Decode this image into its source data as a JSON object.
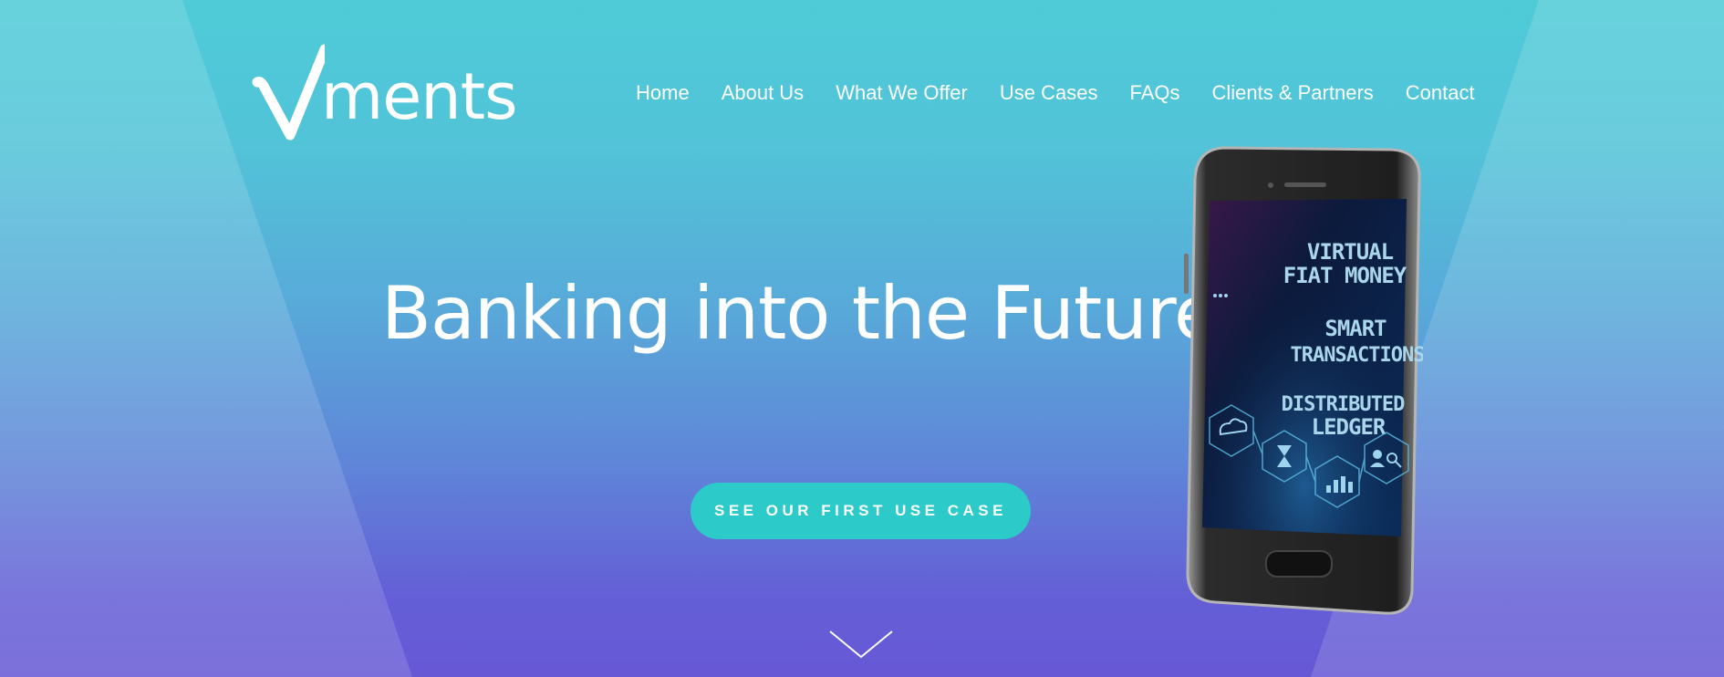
{
  "brand": {
    "logo_text": "ments",
    "logo_icon": "check-mark-icon"
  },
  "nav": {
    "items": [
      {
        "label": "Home"
      },
      {
        "label": "About Us"
      },
      {
        "label": "What We Offer"
      },
      {
        "label": "Use Cases"
      },
      {
        "label": "FAQs"
      },
      {
        "label": "Clients & Partners"
      },
      {
        "label": "Contact"
      }
    ]
  },
  "hero": {
    "headline": "Banking into the Future",
    "cta_label": "SEE OUR FIRST USE CASE",
    "scroll_icon": "chevron-down-icon"
  },
  "phone_screen": {
    "lines": [
      "VIRTUAL",
      "FIAT MONEY",
      "SMART",
      "TRANSACTIONS",
      "DISTRIBUTED",
      "LEDGER"
    ],
    "icons": [
      "cloud-icon",
      "hourglass-icon",
      "bar-chart-icon",
      "user-search-icon"
    ]
  },
  "colors": {
    "bg_top": "#4ecbd7",
    "bg_bottom": "#6758d6",
    "cta": "#2ccac9",
    "text": "#ffffff"
  }
}
